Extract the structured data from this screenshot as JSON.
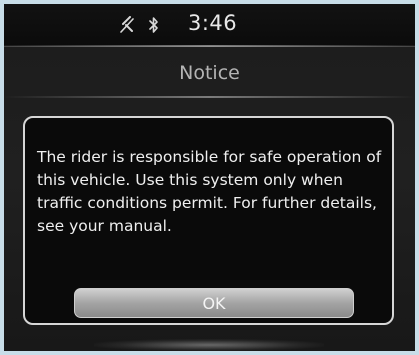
{
  "status_bar": {
    "time": "3:46",
    "icons": [
      "mute-icon",
      "bluetooth-icon"
    ]
  },
  "header": {
    "title": "Notice"
  },
  "dialog": {
    "message": "The rider is responsible for safe operation of this vehicle. Use this system only when traffic conditions permit. For further details, see your manual.",
    "ok_label": "OK"
  },
  "colors": {
    "page_border": "#c8dde8",
    "screen_background": "#1c1c1c",
    "text_primary": "#efefef",
    "header_text": "#b4b4b4",
    "button_gray": "#a4a4a4"
  }
}
